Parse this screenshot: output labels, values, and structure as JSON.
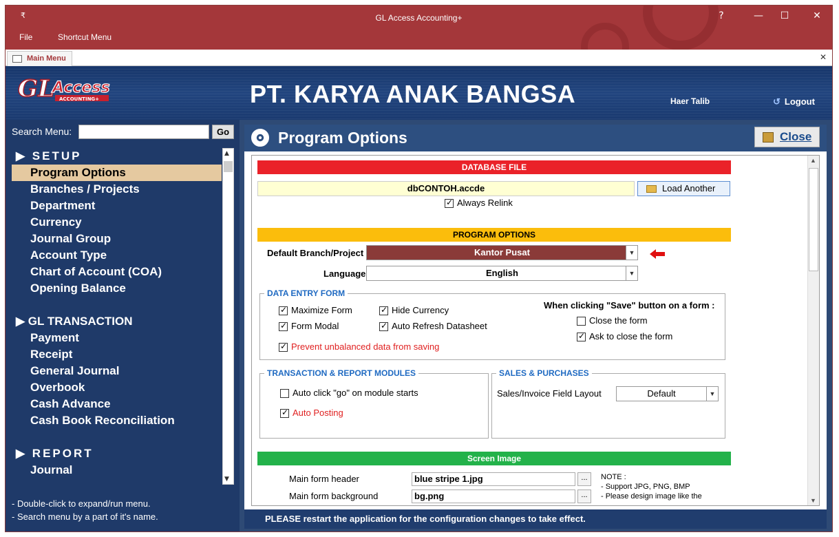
{
  "window": {
    "title": "GL Access Accounting+",
    "controls": {
      "help": "?",
      "minimize": "—",
      "maximize": "☐",
      "close": "✕"
    },
    "qat": "₹"
  },
  "menubar": {
    "file": "File",
    "shortcut_menu": "Shortcut Menu"
  },
  "tab": {
    "label": "Main Menu",
    "close": "✕"
  },
  "header": {
    "company": "PT. KARYA ANAK BANGSA",
    "user": "Haer Talib",
    "logout": "Logout",
    "logo_text": "GLAccess",
    "logo_sub": "ACCOUNTING+"
  },
  "sidebar": {
    "search_label": "Search Menu:",
    "go": "Go",
    "items": [
      {
        "label": "▶ SETUP",
        "type": "section"
      },
      {
        "label": "Program Options",
        "type": "item",
        "selected": true
      },
      {
        "label": "Branches / Projects",
        "type": "item"
      },
      {
        "label": "Department",
        "type": "item"
      },
      {
        "label": "Currency",
        "type": "item"
      },
      {
        "label": "Journal Group",
        "type": "item"
      },
      {
        "label": "Account Type",
        "type": "item"
      },
      {
        "label": "Chart of Account (COA)",
        "type": "item"
      },
      {
        "label": "Opening Balance",
        "type": "item"
      },
      {
        "label": "",
        "type": "gap"
      },
      {
        "label": "▶ GL TRANSACTION",
        "type": "section2"
      },
      {
        "label": "Payment",
        "type": "item"
      },
      {
        "label": "Receipt",
        "type": "item"
      },
      {
        "label": "General Journal",
        "type": "item"
      },
      {
        "label": "Overbook",
        "type": "item"
      },
      {
        "label": "Cash Advance",
        "type": "item"
      },
      {
        "label": "Cash Book Reconciliation",
        "type": "item"
      },
      {
        "label": "",
        "type": "gap"
      },
      {
        "label": "▶ REPORT",
        "type": "section"
      },
      {
        "label": "Journal",
        "type": "item"
      }
    ],
    "hints": [
      "- Double-click to expand/run menu.",
      "- Search menu by a part of it's name."
    ]
  },
  "page": {
    "title": "Program Options",
    "close_label": "Close",
    "database_file_header": "DATABASE FILE",
    "db_file": "dbCONTOH.accde",
    "load_another": "Load Another",
    "always_relink": "Always Relink",
    "program_options_header": "PROGRAM OPTIONS",
    "default_branch_label": "Default Branch/Project",
    "default_branch_value": "Kantor Pusat",
    "language_label": "Language",
    "language_value": "English",
    "data_entry_form": {
      "legend": "DATA ENTRY FORM",
      "maximize_form": "Maximize Form",
      "form_modal": "Form Modal",
      "hide_currency": "Hide Currency",
      "auto_refresh": "Auto Refresh Datasheet",
      "prevent_unbalanced": "Prevent unbalanced data from saving",
      "save_heading": "When clicking \"Save\" button on a form :",
      "close_form": "Close the form",
      "ask_close": "Ask to close the form"
    },
    "transaction_modules": {
      "legend": "TRANSACTION & REPORT MODULES",
      "auto_click_go": "Auto click \"go\" on module starts",
      "auto_posting": "Auto Posting"
    },
    "sales_purchases": {
      "legend": "SALES & PURCHASES",
      "field_layout_label": "Sales/Invoice Field Layout",
      "field_layout_value": "Default"
    },
    "screen_image_header": "Screen Image",
    "main_form_header_label": "Main form header",
    "main_form_header_value": "blue stripe 1.jpg",
    "main_form_bg_label": "Main form background",
    "main_form_bg_value": "bg.png",
    "dots": "...",
    "note": [
      "NOTE :",
      "- Support JPG, PNG, BMP",
      "- Please design image like the"
    ],
    "status": "PLEASE restart the application for the configuration changes to take effect."
  },
  "colors": {
    "titlebar": "#a4373a",
    "sidebar": "#1f3a69",
    "selected": "#e5c9a0",
    "band_red": "#ea2229",
    "band_yellow": "#fbbd0c",
    "band_green": "#23b24a",
    "branch_combo": "#8a3a38"
  }
}
